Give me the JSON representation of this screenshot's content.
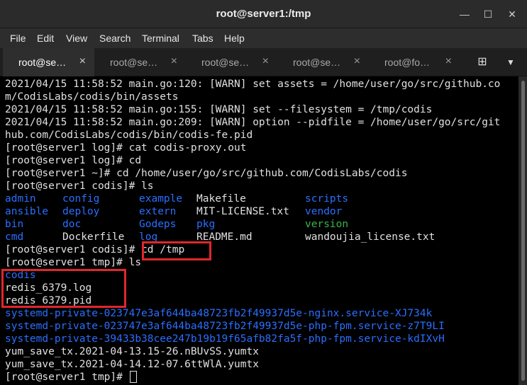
{
  "window": {
    "title": "root@server1:/tmp",
    "minimize_glyph": "—",
    "maximize_glyph": "☐",
    "close_glyph": "✕"
  },
  "menu": [
    "File",
    "Edit",
    "View",
    "Search",
    "Terminal",
    "Tabs",
    "Help"
  ],
  "tabs": [
    {
      "label": "root@se…",
      "active": true
    },
    {
      "label": "root@se…",
      "active": false
    },
    {
      "label": "root@se…",
      "active": false
    },
    {
      "label": "root@se…",
      "active": false
    },
    {
      "label": "root@fo…",
      "active": false
    }
  ],
  "tab_close_glyph": "×",
  "new_tab_glyph": "⊞",
  "tab_menu_glyph": "▼",
  "terminal": {
    "lines": [
      "2021/04/15 11:58:52 main.go:120: [WARN] set assets = /home/user/go/src/github.co",
      "m/CodisLabs/codis/bin/assets",
      "2021/04/15 11:58:52 main.go:155: [WARN] set --filesystem = /tmp/codis",
      "2021/04/15 11:58:52 main.go:209: [WARN] option --pidfile = /home/user/go/src/git",
      "hub.com/CodisLabs/codis/bin/codis-fe.pid",
      "[root@server1 log]# cat codis-proxy.out",
      "[root@server1 log]# cd",
      "[root@server1 ~]# cd /home/user/go/src/github.com/CodisLabs/codis",
      "[root@server1 codis]# ls"
    ],
    "ls_codis": [
      [
        "admin",
        "config",
        "example",
        "Makefile",
        "scripts"
      ],
      [
        "ansible",
        "deploy",
        "extern",
        "MIT-LICENSE.txt",
        "vendor"
      ],
      [
        "bin",
        "doc",
        "Godeps",
        "pkg",
        "version"
      ],
      [
        "cmd",
        "Dockerfile",
        "log",
        "README.md",
        "wandoujia_license.txt"
      ]
    ],
    "prompt_cd_tmp": "[root@server1 codis]# ",
    "cmd_cd_tmp": "cd /tmp",
    "prompt_ls_tmp": "[root@server1 tmp]# ls",
    "tmp_files": [
      "codis",
      "redis_6379.log",
      "redis_6379.pid",
      "systemd-private-023747e3af644ba48723fb2f49937d5e-nginx.service-XJ734k",
      "systemd-private-023747e3af644ba48723fb2f49937d5e-php-fpm.service-z7T9LI",
      "systemd-private-39433b38cee247b19b19f65afb82fa5f-php-fpm.service-kdIXvH",
      "yum_save_tx.2021-04-13.15-26.nBUvSS.yumtx",
      "yum_save_tx.2021-04-14.12-07.6ttWlA.yumtx"
    ],
    "final_prompt": "[root@server1 tmp]# "
  },
  "colors": {
    "dir_blue": "#2a6fff",
    "exec_green": "#39b54a",
    "highlight_red": "#e0262b"
  }
}
